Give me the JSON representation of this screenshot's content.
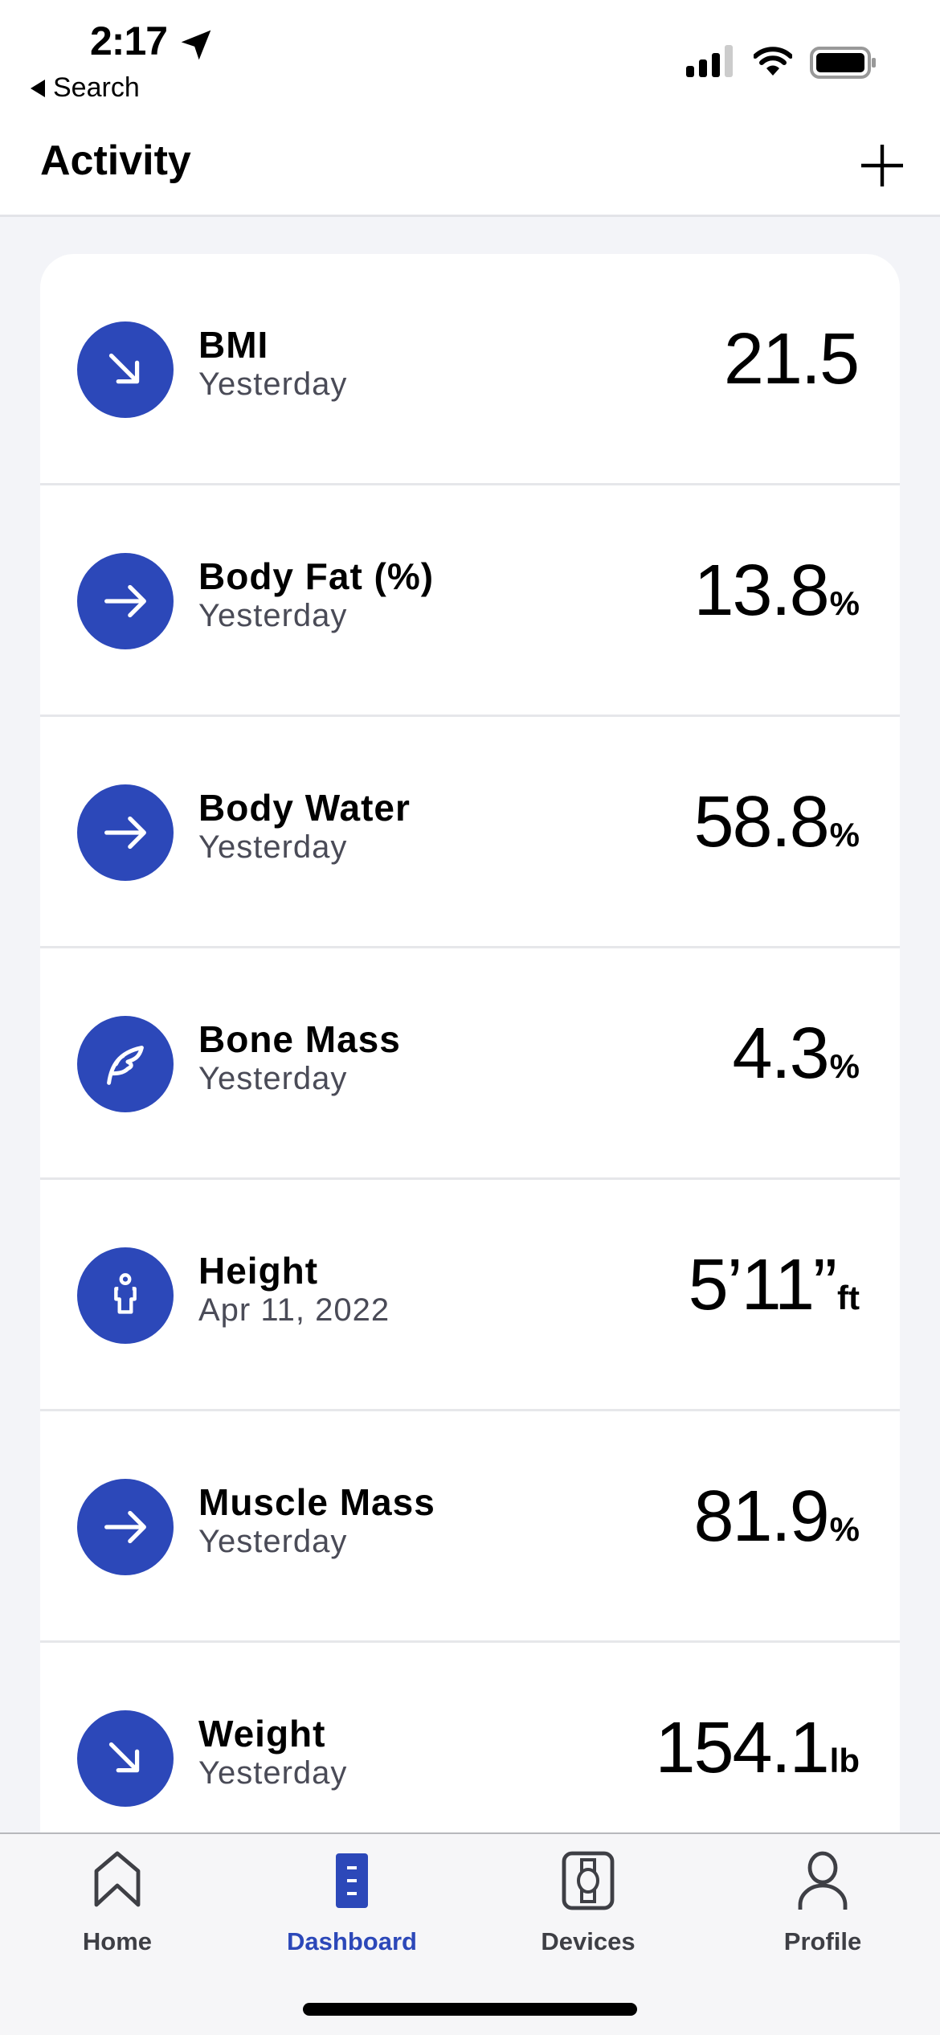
{
  "status_bar": {
    "time": "2:17",
    "back_label": "Search",
    "icons": [
      "location-arrow-icon",
      "cellular-signal-icon",
      "wifi-icon",
      "battery-icon"
    ]
  },
  "nav": {
    "title": "Activity",
    "add_icon": "plus-icon"
  },
  "colors": {
    "accent": "#2c48b9",
    "background": "#f3f4f8",
    "card": "#ffffff",
    "secondary_text": "#4a4b57"
  },
  "metrics": [
    {
      "name": "BMI",
      "date": "Yesterday",
      "value": "21.5",
      "unit": "",
      "icon": "trend-down-arrow-icon"
    },
    {
      "name": "Body Fat (%)",
      "date": "Yesterday",
      "value": "13.8",
      "unit": "%",
      "icon": "trend-flat-arrow-icon"
    },
    {
      "name": "Body Water",
      "date": "Yesterday",
      "value": "58.8",
      "unit": "%",
      "icon": "trend-flat-arrow-icon"
    },
    {
      "name": "Bone Mass",
      "date": "Yesterday",
      "value": "4.3",
      "unit": "%",
      "icon": "feather-icon"
    },
    {
      "name": "Height",
      "date": "Apr 11, 2022",
      "value": "5’11”",
      "unit": "ft",
      "icon": "person-icon"
    },
    {
      "name": "Muscle Mass",
      "date": "Yesterday",
      "value": "81.9",
      "unit": "%",
      "icon": "trend-flat-arrow-icon"
    },
    {
      "name": "Weight",
      "date": "Yesterday",
      "value": "154.1",
      "unit": "lb",
      "icon": "trend-down-arrow-icon"
    }
  ],
  "tabs": [
    {
      "label": "Home",
      "icon": "home-icon",
      "active": false
    },
    {
      "label": "Dashboard",
      "icon": "dashboard-icon",
      "active": true
    },
    {
      "label": "Devices",
      "icon": "watch-device-icon",
      "active": false
    },
    {
      "label": "Profile",
      "icon": "profile-icon",
      "active": false
    }
  ]
}
